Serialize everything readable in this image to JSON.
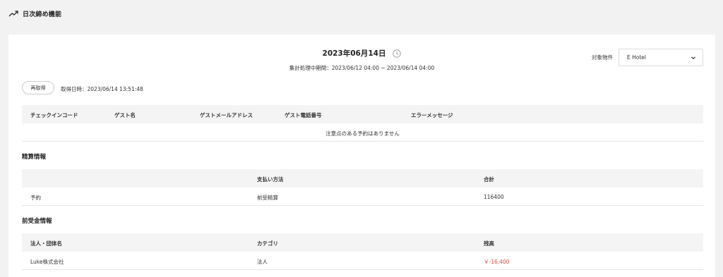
{
  "header": {
    "title": "日次締め機能",
    "icon": "trending-up-icon"
  },
  "summary": {
    "date": "2023年06月14日",
    "range": "集計処理中期間：2023/06/12 04:00 ~ 2023/06/14 04:00"
  },
  "property": {
    "label": "対象物件",
    "value": "E Hotel"
  },
  "refetch": {
    "button": "再取得",
    "fetched_at": "取得日時：2023/06/14 13:51:48"
  },
  "checkin_table": {
    "columns": [
      "チェックインコード",
      "ゲスト名",
      "ゲストメールアドレス",
      "ゲスト電話番号",
      "エラーメッセージ"
    ],
    "empty_message": "注意点のある予約はありません"
  },
  "settlement": {
    "title": "精算情報",
    "columns": [
      "",
      "支払い方法",
      "合計"
    ],
    "rows": [
      [
        "予約",
        "前受精算",
        "116400"
      ]
    ]
  },
  "advance": {
    "title": "前受金情報",
    "columns": [
      "法人・団体名",
      "カテゴリ",
      "残高"
    ],
    "rows": [
      [
        "Luke株式会社",
        "法人",
        "￥-16,400"
      ]
    ]
  },
  "colors": {
    "negative": "#e74c3c",
    "header_bg": "#f4f4f4",
    "page_bg": "#f2f2f2"
  }
}
